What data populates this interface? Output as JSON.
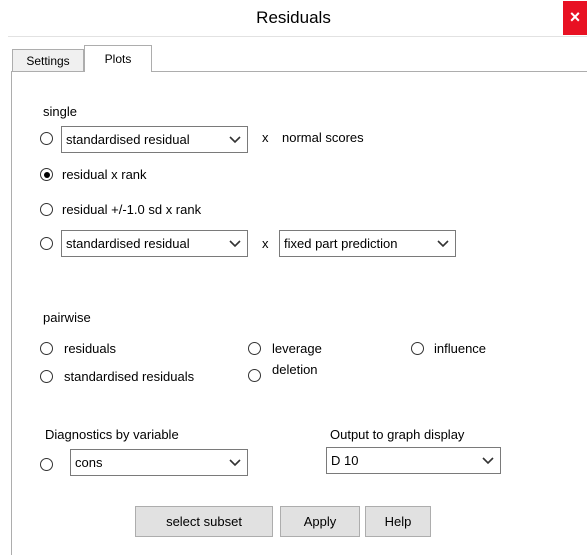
{
  "window": {
    "title": "Residuals",
    "close_glyph": "×"
  },
  "tabs": [
    {
      "label": "Settings"
    },
    {
      "label": "Plots",
      "selected": true
    }
  ],
  "single": {
    "heading": "single",
    "row1": {
      "selected": false,
      "combo": "standardised residual",
      "times": "x",
      "suffix": "normal scores"
    },
    "row2": {
      "selected": true,
      "label": "residual x rank"
    },
    "row3": {
      "selected": false,
      "label": "residual +/-1.0 sd x  rank"
    },
    "row4": {
      "selected": false,
      "combo": "standardised residual",
      "times": "x",
      "combo2": "fixed part prediction"
    }
  },
  "pairwise": {
    "heading": "pairwise",
    "options": [
      {
        "label": "residuals",
        "selected": false
      },
      {
        "label": "leverage",
        "selected": false
      },
      {
        "label": "influence",
        "selected": false
      },
      {
        "label": "standardised residuals",
        "selected": false
      },
      {
        "label": "deletion",
        "selected": false
      }
    ]
  },
  "diagnostics": {
    "heading": "Diagnostics by variable",
    "selected": false,
    "combo": "cons"
  },
  "output": {
    "heading": "Output to graph display",
    "combo": "D 10"
  },
  "buttons": {
    "select_subset": "select subset",
    "apply": "Apply",
    "help": "Help"
  },
  "icons": {
    "dropdown": "chevron-down-icon",
    "close": "close-icon"
  },
  "colors": {
    "close_bg": "#e81123",
    "button_bg": "#e1e1e1",
    "border": "#adadad"
  }
}
